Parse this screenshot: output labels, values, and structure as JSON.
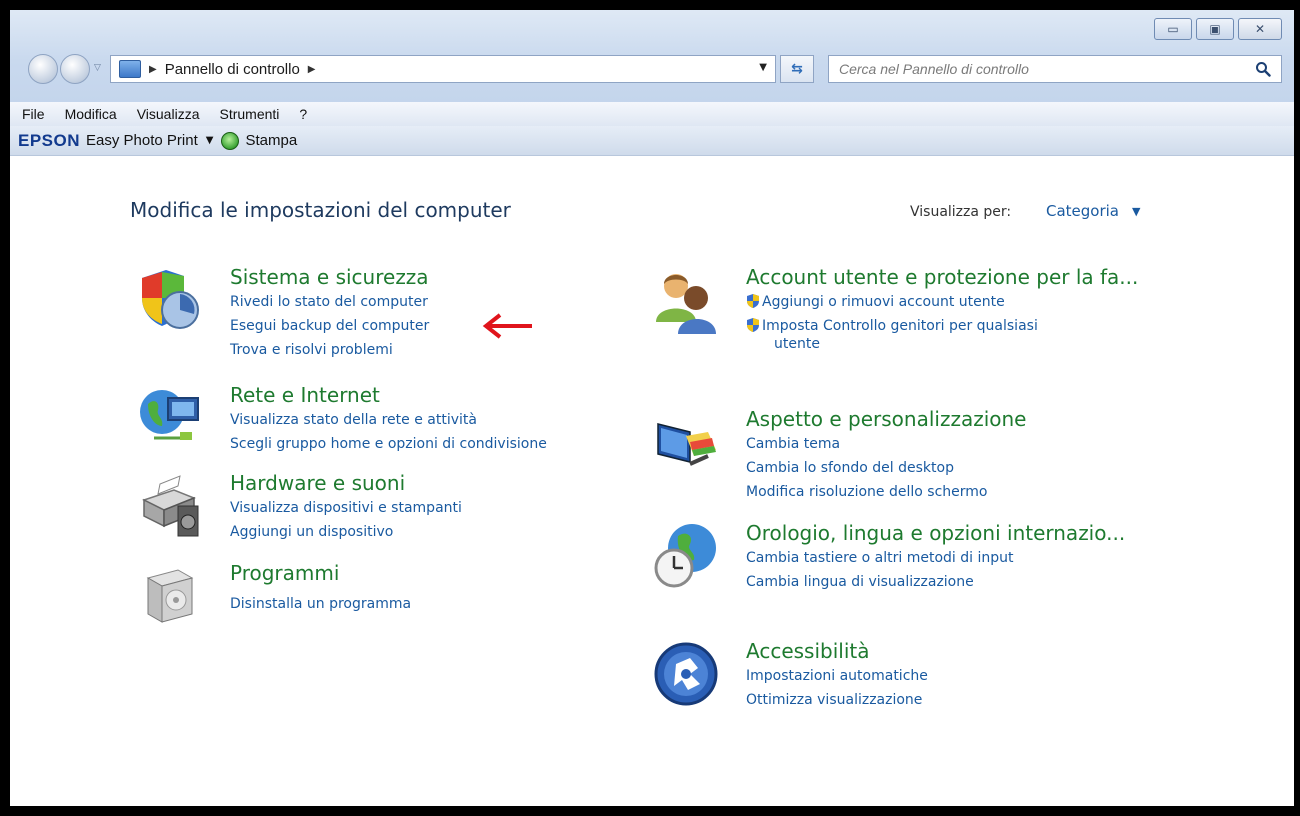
{
  "address": {
    "crumb": "Pannello di controllo",
    "search_placeholder": "Cerca nel Pannello di controllo"
  },
  "menu": [
    "File",
    "Modifica",
    "Visualizza",
    "Strumenti",
    "?"
  ],
  "toolbar": {
    "brand": "EPSON",
    "app_label": "Easy Photo Print",
    "print_label": "Stampa"
  },
  "main": {
    "title": "Modifica le impostazioni del computer",
    "view_by_label": "Visualizza per:",
    "view_by_value": "Categoria"
  },
  "categories_left": [
    {
      "title": "Sistema e sicurezza",
      "links": [
        "Rivedi lo stato del computer",
        "Esegui backup del computer",
        "Trova e risolvi problemi"
      ]
    },
    {
      "title": "Rete e Internet",
      "links": [
        "Visualizza stato della rete e attività",
        "Scegli gruppo home e opzioni di condivisione"
      ]
    },
    {
      "title": "Hardware e suoni",
      "links": [
        "Visualizza dispositivi e stampanti",
        "Aggiungi un dispositivo"
      ]
    },
    {
      "title": "Programmi",
      "links": [
        "Disinstalla un programma"
      ]
    }
  ],
  "categories_right": [
    {
      "title": "Account utente e protezione per la fa...",
      "links": [
        "Aggiungi o rimuovi account utente",
        "Imposta Controllo genitori per qualsiasi",
        "utente"
      ]
    },
    {
      "title": "Aspetto e personalizzazione",
      "links": [
        "Cambia tema",
        "Cambia lo sfondo del desktop",
        "Modifica risoluzione dello schermo"
      ]
    },
    {
      "title": "Orologio, lingua e opzioni internazio...",
      "links": [
        "Cambia tastiere o altri metodi di input",
        "Cambia lingua di visualizzazione"
      ]
    },
    {
      "title": "Accessibilità",
      "links": [
        "Impostazioni automatiche",
        "Ottimizza visualizzazione"
      ]
    }
  ],
  "colors": {
    "category_title": "#1e7a2f",
    "link": "#1a5aa0",
    "annotation_arrow": "#e0141c"
  }
}
